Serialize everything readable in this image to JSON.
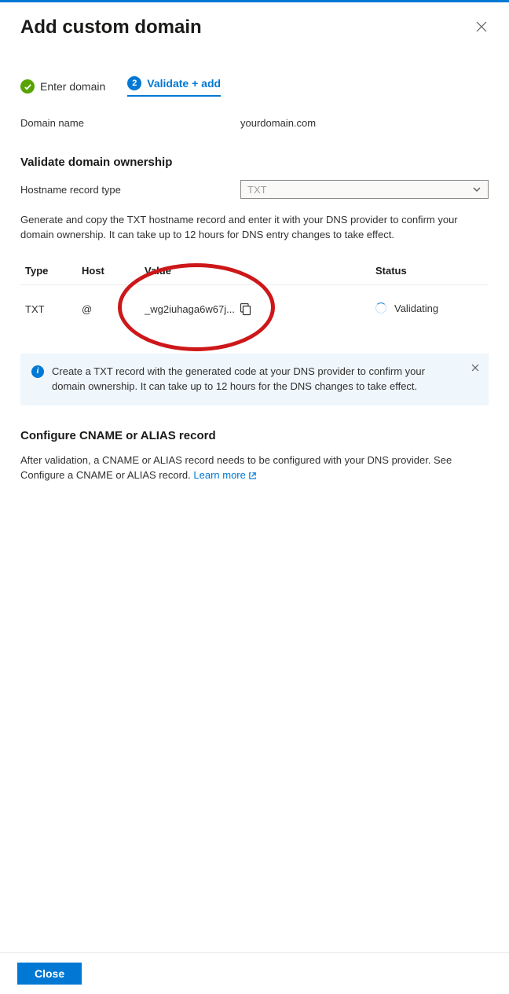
{
  "header": {
    "title": "Add custom domain"
  },
  "steps": {
    "step1_label": "Enter domain",
    "step2_num": "2",
    "step2_label": "Validate + add"
  },
  "domain": {
    "label": "Domain name",
    "value": "yourdomain.com"
  },
  "ownership": {
    "section_title": "Validate domain ownership",
    "record_type_label": "Hostname record type",
    "record_type_value": "TXT",
    "help_text": "Generate and copy the TXT hostname record and enter it with your DNS provider to confirm your domain ownership. It can take up to 12 hours for DNS entry changes to take effect."
  },
  "table": {
    "headers": {
      "type": "Type",
      "host": "Host",
      "value": "Value",
      "status": "Status"
    },
    "row": {
      "type": "TXT",
      "host": "@",
      "value": "_wg2iuhaga6w67j...",
      "status": "Validating"
    }
  },
  "info": {
    "text": "Create a TXT record with the generated code at your DNS provider to confirm your domain ownership. It can take up to 12 hours for the DNS changes to take effect."
  },
  "cname": {
    "title": "Configure CNAME or ALIAS record",
    "text": "After validation, a CNAME or ALIAS record needs to be configured with your DNS provider. See Configure a CNAME or ALIAS record.  ",
    "learn_more": "Learn more"
  },
  "footer": {
    "close_label": "Close"
  }
}
